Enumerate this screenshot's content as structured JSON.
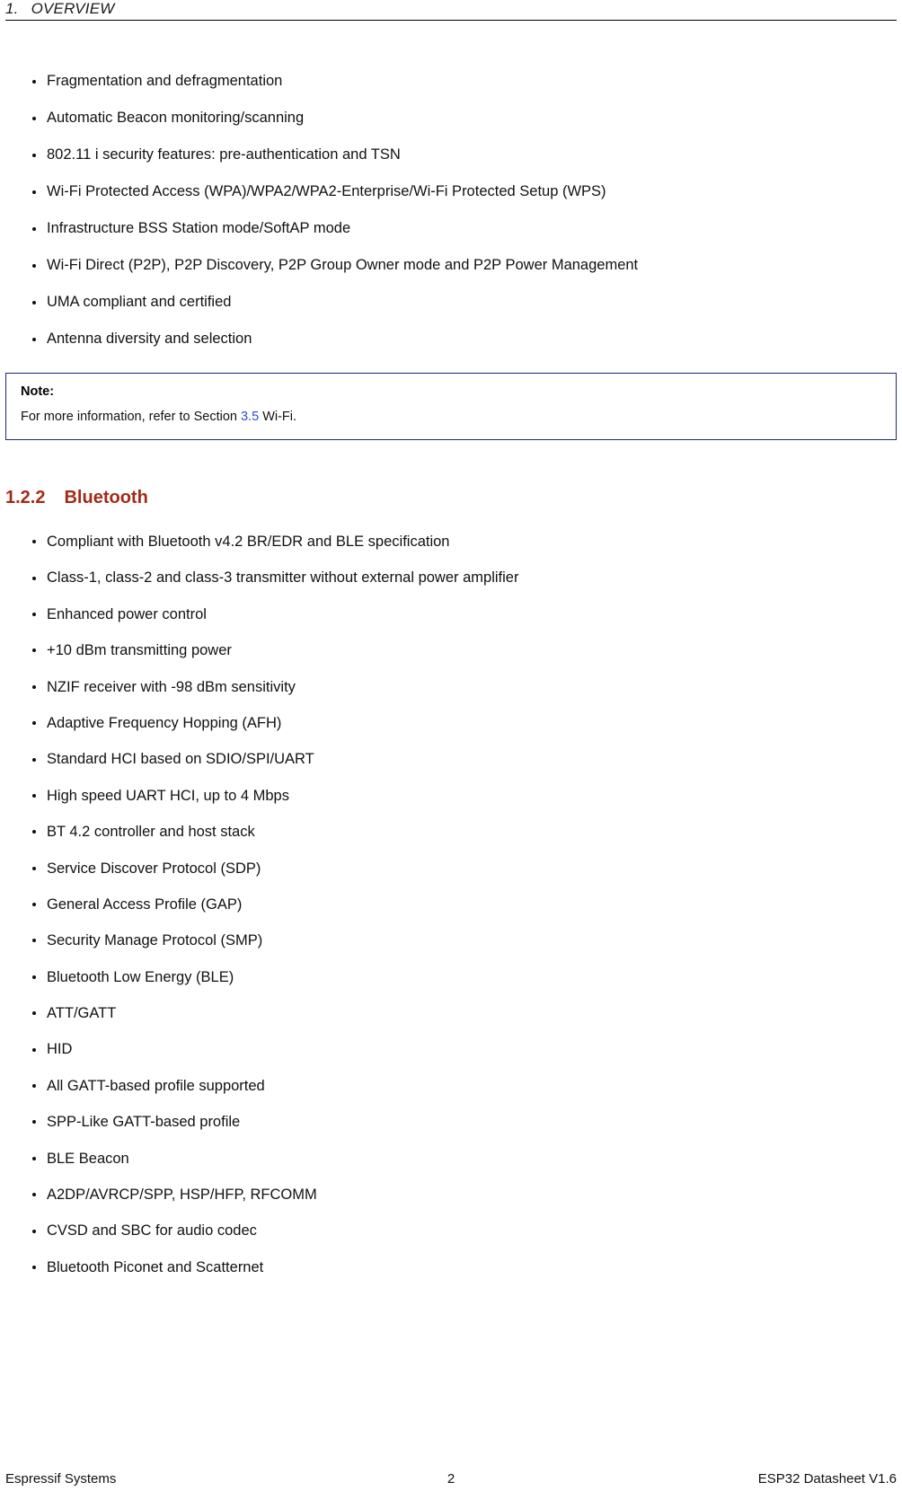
{
  "header": {
    "chapter_number": "1.",
    "chapter_title": "OVERVIEW"
  },
  "wifi_features": [
    "Fragmentation and defragmentation",
    "Automatic Beacon monitoring/scanning",
    "802.11 i security features: pre-authentication and TSN",
    "Wi-Fi Protected Access (WPA)/WPA2/WPA2-Enterprise/Wi-Fi Protected Setup (WPS)",
    "Infrastructure BSS Station mode/SoftAP mode",
    "Wi-Fi Direct (P2P), P2P Discovery, P2P Group Owner mode and P2P Power Management",
    "UMA compliant and certified",
    "Antenna diversity and selection"
  ],
  "note": {
    "title": "Note:",
    "text_before": "For more information, refer to Section ",
    "link": "3.5",
    "text_after": " Wi-Fi.",
    "border_color": "#1b2a78",
    "link_color": "#2b4fd8"
  },
  "section": {
    "number": "1.2.2",
    "title": "Bluetooth",
    "color": "#a32a19"
  },
  "bluetooth_features": [
    "Compliant with Bluetooth v4.2 BR/EDR and BLE specification",
    "Class-1, class-2 and class-3 transmitter without external power amplifier",
    "Enhanced power control",
    "+10 dBm transmitting power",
    "NZIF receiver with -98 dBm sensitivity",
    "Adaptive Frequency Hopping (AFH)",
    "Standard HCI based on SDIO/SPI/UART",
    "High speed UART HCI, up to 4 Mbps",
    "BT 4.2 controller and host stack",
    "Service Discover Protocol (SDP)",
    "General Access Profile (GAP)",
    "Security Manage Protocol (SMP)",
    "Bluetooth Low Energy (BLE)",
    "ATT/GATT",
    "HID",
    "All GATT-based profile supported",
    "SPP-Like GATT-based profile",
    "BLE Beacon",
    "A2DP/AVRCP/SPP, HSP/HFP, RFCOMM",
    "CVSD and SBC for audio codec",
    "Bluetooth Piconet and Scatternet"
  ],
  "footer": {
    "left": "Espressif Systems",
    "page_number": "2",
    "right": "ESP32 Datasheet V1.6"
  }
}
